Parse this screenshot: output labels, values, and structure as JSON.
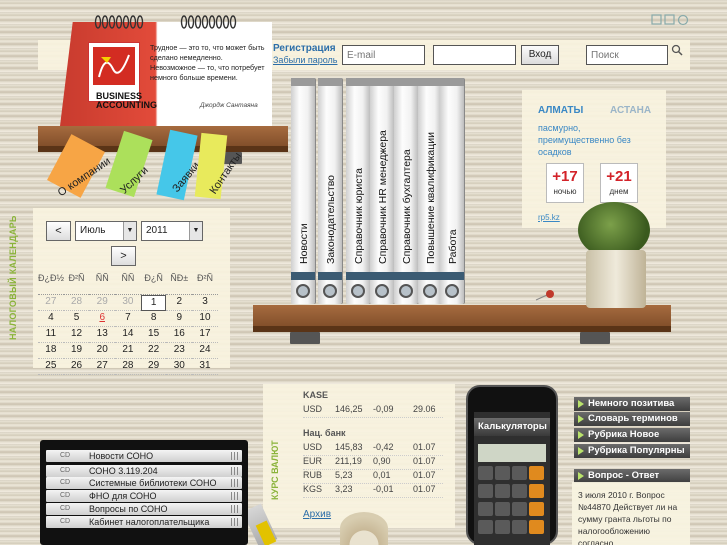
{
  "header": {
    "registration_label": "Регистрация",
    "forgot_password_label": "Забыли пароль",
    "email_placeholder": "E-mail",
    "password_value": "",
    "login_button": "Вход",
    "search_placeholder": "Поиск"
  },
  "logo": {
    "title_line1": "BUSINESS",
    "title_line2": "ACCOUNTING",
    "quote": "Трудное — это то, что может быть сделано немедленно. Невозможное — то, что потребует немного больше времени.",
    "quote_author": "Джордж Сантаяна"
  },
  "nav_stickers": [
    {
      "label": "О компании",
      "color": "#f7a545"
    },
    {
      "label": "Услуги",
      "color": "#ace05b"
    },
    {
      "label": "Заявки",
      "color": "#45c7e9"
    },
    {
      "label": "Контакты",
      "color": "#e8ea5c"
    }
  ],
  "tax_calendar": {
    "vertical_title": "НАЛОГОВЫЙ КАЛЕНДАРЬ",
    "prev_button": "<",
    "next_button": ">",
    "month": "Июль",
    "year": "2011",
    "weekdays": [
      "Ð¿Ð½",
      "Ð²Ñ",
      "ÑÑ",
      "ÑÑ",
      "Ð¿Ñ",
      "ÑÐ±",
      "Ð²Ñ"
    ],
    "weeks": [
      [
        "27",
        "28",
        "29",
        "30",
        "1",
        "2",
        "3"
      ],
      [
        "4",
        "5",
        "6",
        "7",
        "8",
        "9",
        "10"
      ],
      [
        "11",
        "12",
        "13",
        "14",
        "15",
        "16",
        "17"
      ],
      [
        "18",
        "19",
        "20",
        "21",
        "22",
        "23",
        "24"
      ],
      [
        "25",
        "26",
        "27",
        "28",
        "29",
        "30",
        "31"
      ]
    ]
  },
  "binders": [
    {
      "label": "Новости"
    },
    {
      "label": "Законодательство"
    },
    {
      "label": "Справочник юриста"
    },
    {
      "label": "Справочник HR менеджера"
    },
    {
      "label": "Справочник бухгалтера"
    },
    {
      "label": "Повышение квалификации"
    },
    {
      "label": "Работа"
    }
  ],
  "weather": {
    "city_active": "АЛМАТЫ",
    "city_other": "АСТАНА",
    "description": "пасмурно, преимущественно без осадков",
    "night_temp": "+17",
    "night_label": "ночью",
    "day_temp": "+21",
    "day_label": "днем",
    "source": "rp5.kz"
  },
  "currency": {
    "vertical_title": "КУРС ВАЛЮТ",
    "kase_title": "KASE",
    "kase_rows": [
      [
        "USD",
        "146,25",
        "-0,09",
        "29.06"
      ]
    ],
    "nb_title": "Нац. банк",
    "nb_rows": [
      [
        "USD",
        "145,83",
        "-0,42",
        "01.07"
      ],
      [
        "EUR",
        "211,19",
        "0,90",
        "01.07"
      ],
      [
        "RUB",
        "5,23",
        "0,01",
        "01.07"
      ],
      [
        "KGS",
        "3,23",
        "-0,01",
        "01.07"
      ]
    ],
    "archive_label": "Архив"
  },
  "calculator": {
    "label": "Калькуляторы"
  },
  "rubrics": {
    "items": [
      {
        "label": "Немного позитива"
      },
      {
        "label": "Словарь терминов"
      },
      {
        "label": "Рубрика Новое"
      },
      {
        "label": "Рубрика Популярны"
      },
      {
        "label": "Вопрос - Ответ"
      }
    ],
    "qa_text": "3 июля 2010 г. Вопрос №44870 Действует ли на сумму гранта льготы по налогообложению согласно..."
  },
  "cd_list": {
    "tag": "CD",
    "items": [
      {
        "label": "Новости СОНО"
      },
      {
        "label": "СОНО 3.119.204"
      },
      {
        "label": "Системные библиотеки СОНО"
      },
      {
        "label": "ФНО для СОНО"
      },
      {
        "label": "Вопросы по СОНО"
      },
      {
        "label": "Кабинет налогоплательщика"
      }
    ]
  },
  "colors": {
    "link_blue": "#2c6ea8",
    "calendar_green": "#8ab33a",
    "temp_red": "#d3232a",
    "shelf_wood": "#8d5830"
  },
  "icons": [
    "search-icon",
    "corner-icons",
    "pin-icon",
    "caret-down-icon",
    "arrow-right-icon"
  ]
}
